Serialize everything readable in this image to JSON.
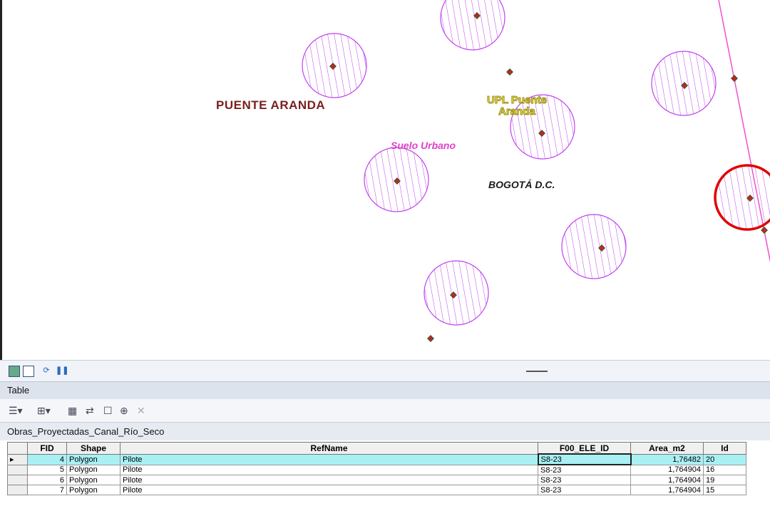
{
  "map": {
    "labels": {
      "puente_aranda": "PUENTE ARANDA",
      "upl_line1": "UPL Puente",
      "upl_line2": "Aranda",
      "suelo_urbano": "Suelo Urbano",
      "bogota": "BOGOTÁ D.C."
    },
    "colors": {
      "pilote_fill": "#c040f0",
      "selected_outline": "#e00000",
      "boundary_line": "#f050d0",
      "point_marker": "#d02020"
    }
  },
  "mini_toolbar": {
    "icons": [
      "table-view-icon",
      "layout-view-icon",
      "refresh-icon",
      "pause-icon"
    ]
  },
  "table_panel": {
    "title": "Table",
    "layer_name": "Obras_Proyectadas_Canal_Río_Seco",
    "columns": [
      "FID",
      "Shape",
      "RefName",
      "F00_ELE_ID",
      "Area_m2",
      "Id"
    ],
    "rows": [
      {
        "fid": "4",
        "shape": "Polygon",
        "refname": "Pilote",
        "ele_id": "S8-23",
        "area": "1,76482",
        "id": "20"
      },
      {
        "fid": "5",
        "shape": "Polygon",
        "refname": "Pilote",
        "ele_id": "S8-23",
        "area": "1,764904",
        "id": "16"
      },
      {
        "fid": "6",
        "shape": "Polygon",
        "refname": "Pilote",
        "ele_id": "S8-23",
        "area": "1,764904",
        "id": "19"
      },
      {
        "fid": "7",
        "shape": "Polygon",
        "refname": "Pilote",
        "ele_id": "S8-23",
        "area": "1,764904",
        "id": "15"
      }
    ],
    "current_row_marker": "▸"
  }
}
